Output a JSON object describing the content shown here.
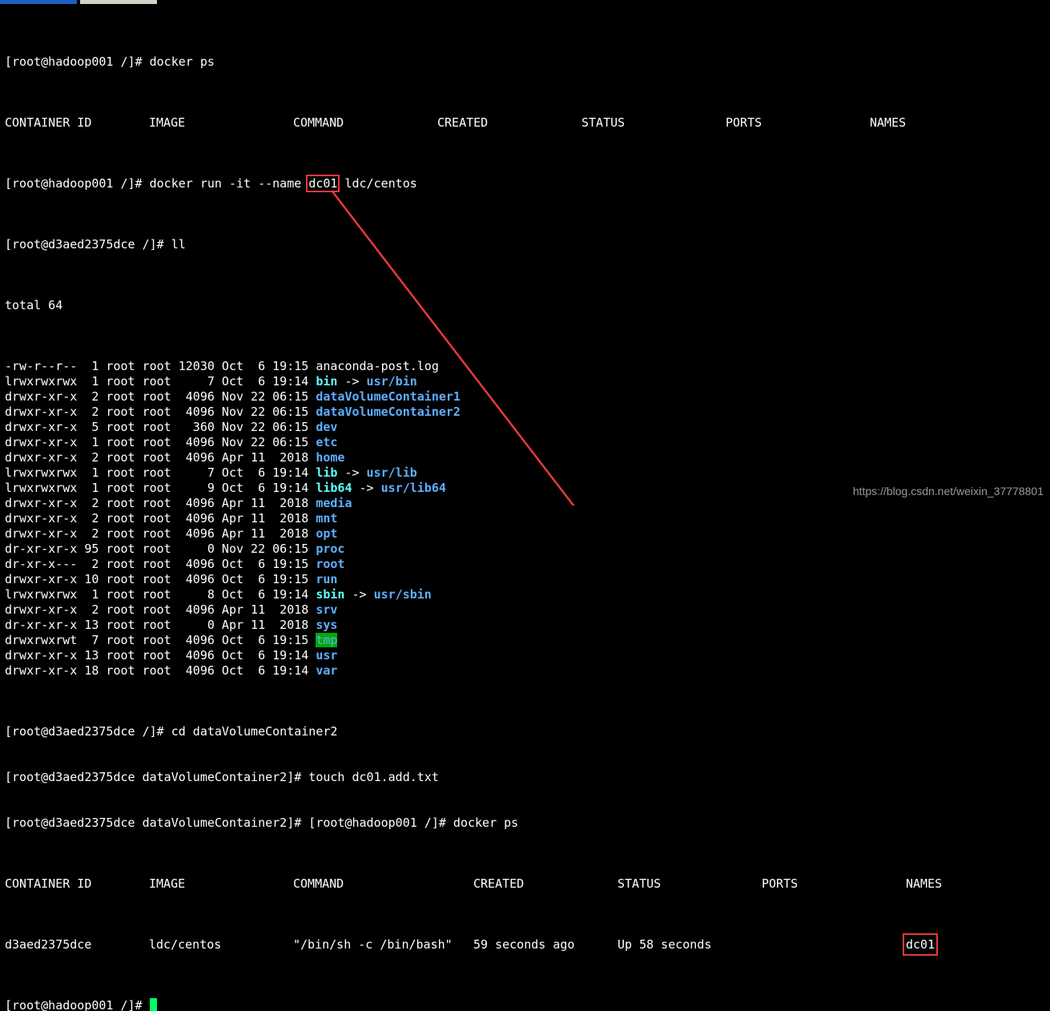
{
  "terminal": {
    "lines": [
      {
        "prompt": "[root@hadoop001 /]# ",
        "cmd": "docker ps"
      },
      {
        "header": [
          "CONTAINER ID",
          "IMAGE",
          "COMMAND",
          "CREATED",
          "STATUS",
          "PORTS",
          "NAMES"
        ]
      },
      {
        "prompt": "[root@hadoop001 /]# ",
        "cmd_pre": "docker run -it --name ",
        "cmd_hl": "dc01",
        "cmd_post": " ldc/centos"
      },
      {
        "prompt": "[root@d3aed2375dce /]# ",
        "cmd": "ll"
      },
      {
        "text": "total 64"
      }
    ],
    "listing": [
      {
        "meta": "-rw-r--r--  1 root root 12030 Oct  6 19:15 ",
        "name": "anaconda-post.log",
        "kind": "file"
      },
      {
        "meta": "lrwxrwxrwx  1 root root     7 Oct  6 19:14 ",
        "name": "bin",
        "kind": "link",
        "target": "usr/bin"
      },
      {
        "meta": "drwxr-xr-x  2 root root  4096 Nov 22 06:15 ",
        "name": "dataVolumeContainer1",
        "kind": "dir"
      },
      {
        "meta": "drwxr-xr-x  2 root root  4096 Nov 22 06:15 ",
        "name": "dataVolumeContainer2",
        "kind": "dir"
      },
      {
        "meta": "drwxr-xr-x  5 root root   360 Nov 22 06:15 ",
        "name": "dev",
        "kind": "dir"
      },
      {
        "meta": "drwxr-xr-x  1 root root  4096 Nov 22 06:15 ",
        "name": "etc",
        "kind": "dir"
      },
      {
        "meta": "drwxr-xr-x  2 root root  4096 Apr 11  2018 ",
        "name": "home",
        "kind": "dir"
      },
      {
        "meta": "lrwxrwxrwx  1 root root     7 Oct  6 19:14 ",
        "name": "lib",
        "kind": "link",
        "target": "usr/lib"
      },
      {
        "meta": "lrwxrwxrwx  1 root root     9 Oct  6 19:14 ",
        "name": "lib64",
        "kind": "link",
        "target": "usr/lib64"
      },
      {
        "meta": "drwxr-xr-x  2 root root  4096 Apr 11  2018 ",
        "name": "media",
        "kind": "dir"
      },
      {
        "meta": "drwxr-xr-x  2 root root  4096 Apr 11  2018 ",
        "name": "mnt",
        "kind": "dir"
      },
      {
        "meta": "drwxr-xr-x  2 root root  4096 Apr 11  2018 ",
        "name": "opt",
        "kind": "dir"
      },
      {
        "meta": "dr-xr-xr-x 95 root root     0 Nov 22 06:15 ",
        "name": "proc",
        "kind": "dir"
      },
      {
        "meta": "dr-xr-x---  2 root root  4096 Oct  6 19:15 ",
        "name": "root",
        "kind": "dir"
      },
      {
        "meta": "drwxr-xr-x 10 root root  4096 Oct  6 19:15 ",
        "name": "run",
        "kind": "dir"
      },
      {
        "meta": "lrwxrwxrwx  1 root root     8 Oct  6 19:14 ",
        "name": "sbin",
        "kind": "link",
        "target": "usr/sbin"
      },
      {
        "meta": "drwxr-xr-x  2 root root  4096 Apr 11  2018 ",
        "name": "srv",
        "kind": "dir"
      },
      {
        "meta": "dr-xr-xr-x 13 root root     0 Apr 11  2018 ",
        "name": "sys",
        "kind": "dir"
      },
      {
        "meta": "drwxrwxrwt  7 root root  4096 Oct  6 19:15 ",
        "name": "tmp",
        "kind": "tmp"
      },
      {
        "meta": "drwxr-xr-x 13 root root  4096 Oct  6 19:14 ",
        "name": "usr",
        "kind": "dir"
      },
      {
        "meta": "drwxr-xr-x 18 root root  4096 Oct  6 19:14 ",
        "name": "var",
        "kind": "dir"
      }
    ],
    "after": [
      {
        "prompt": "[root@d3aed2375dce /]# ",
        "cmd": "cd dataVolumeContainer2"
      },
      {
        "prompt": "[root@d3aed2375dce dataVolumeContainer2]# ",
        "cmd": "touch dc01.add.txt"
      },
      {
        "prompt": "[root@d3aed2375dce dataVolumeContainer2]# ",
        "cmd": "[root@hadoop001 /]# docker ps"
      }
    ],
    "ps_header": [
      "CONTAINER ID",
      "IMAGE",
      "COMMAND",
      "CREATED",
      "STATUS",
      "PORTS",
      "NAMES"
    ],
    "ps_row": [
      "d3aed2375dce",
      "ldc/centos",
      "\"/bin/sh -c /bin/bash\"",
      "59 seconds ago",
      "Up 58 seconds",
      "",
      "dc01"
    ],
    "final_prompt": "[root@hadoop001 /]# "
  },
  "arrow_arrow": "→",
  "link_arrow": " -> ",
  "watermark": "https://blog.csdn.net/weixin_37778801",
  "colors": {
    "background": "#000000",
    "text": "#ffffff",
    "directory": "#5fafff",
    "symlink": "#5fffff",
    "tmp_background": "#00aa00",
    "cursor": "#00ff66",
    "annotation": "#e8393a"
  }
}
